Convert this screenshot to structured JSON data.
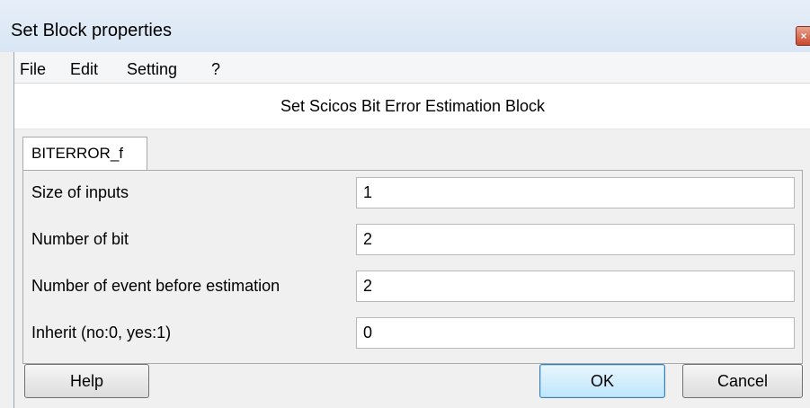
{
  "window": {
    "title": "Set Block properties",
    "close_icon": "close-icon"
  },
  "menu": {
    "items": [
      "File",
      "Edit",
      "Setting",
      "?"
    ]
  },
  "dialog": {
    "heading": "Set Scicos Bit Error Estimation Block",
    "tab": "BITERROR_f"
  },
  "fields": [
    {
      "label": "Size of inputs",
      "value": "1"
    },
    {
      "label": "Number of bit",
      "value": "2"
    },
    {
      "label": "Number of event before estimation",
      "value": "2"
    },
    {
      "label": "Inherit (no:0, yes:1)",
      "value": "0"
    }
  ],
  "buttons": {
    "help": "Help",
    "ok": "OK",
    "cancel": "Cancel"
  }
}
